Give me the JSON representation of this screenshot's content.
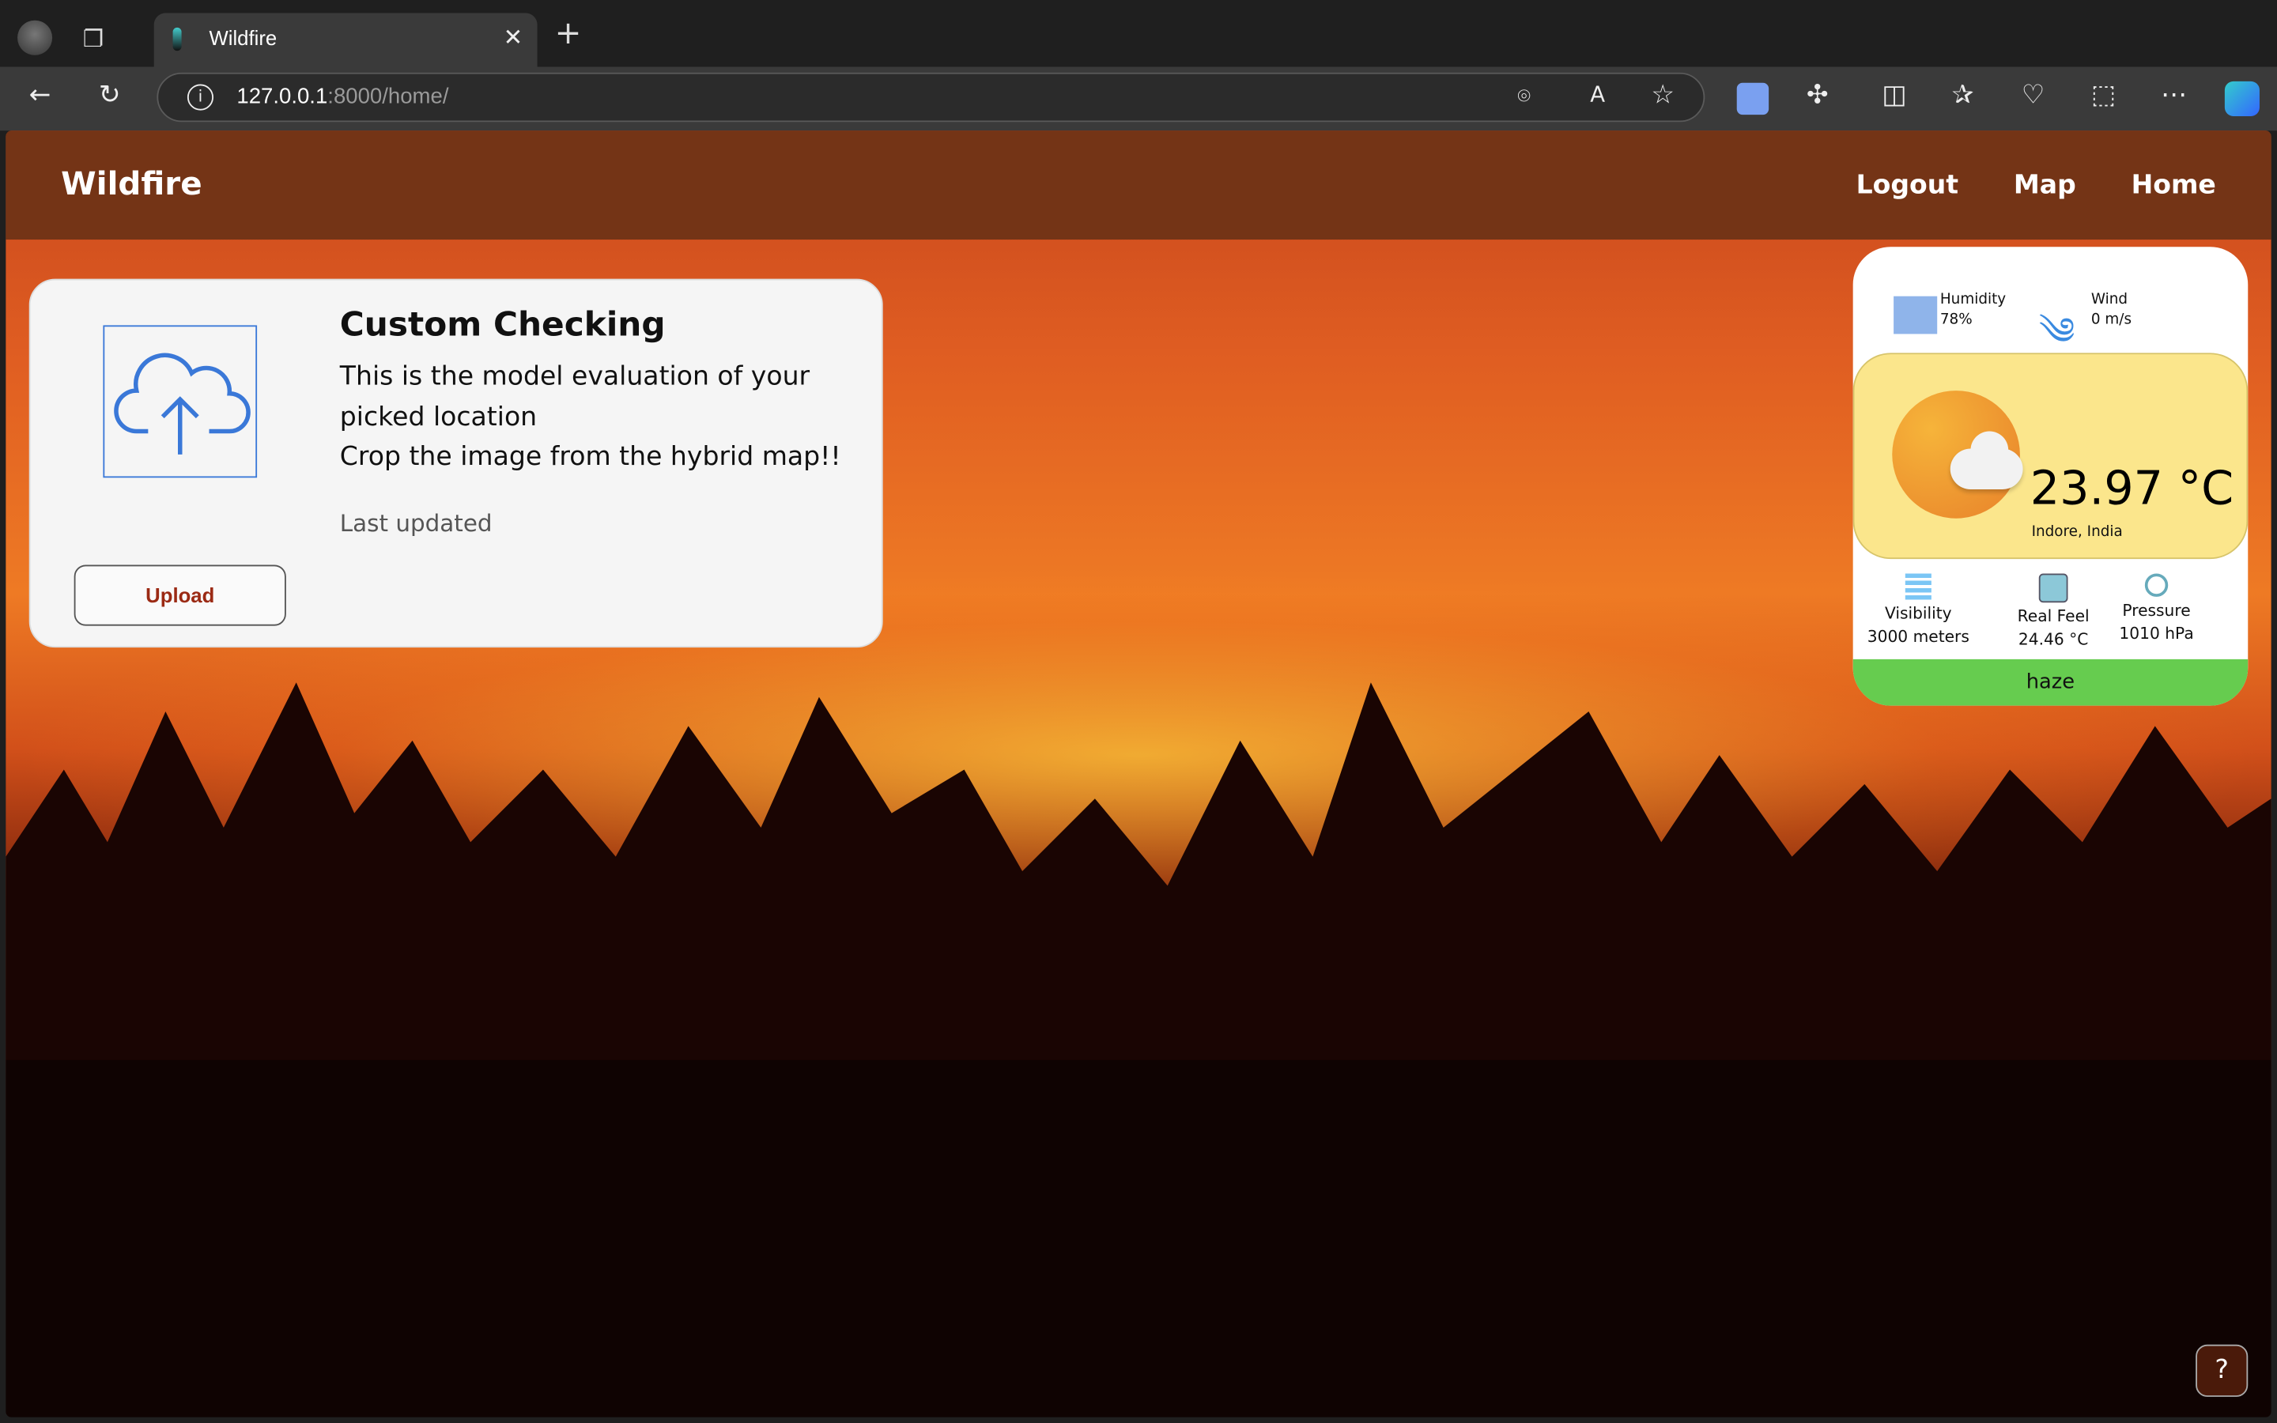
{
  "browser": {
    "tab_title": "Wildfire",
    "url_host": "127.0.0.1",
    "url_rest": ":8000/home/"
  },
  "navbar": {
    "brand": "Wildfire",
    "links": [
      "Logout",
      "Map",
      "Home"
    ]
  },
  "card": {
    "title": "Custom Checking",
    "line1": "This is the model evaluation of your picked location",
    "line2": "Crop the image from the hybrid map!!",
    "last_updated": "Last updated",
    "upload_label": "Upload"
  },
  "weather": {
    "humidity_label": "Humidity",
    "humidity_value": "78%",
    "wind_label": "Wind",
    "wind_value": "0 m/s",
    "temperature": "23.97 °C",
    "location": "Indore, India",
    "visibility_label": "Visibility",
    "visibility_value": "3000 meters",
    "realfeel_label": "Real Feel",
    "realfeel_value": "24.46 °C",
    "pressure_label": "Pressure",
    "pressure_value": "1010 hPa",
    "condition": "haze",
    "colors": {
      "main": "#fbe68c",
      "condition_bar": "#66cc4f"
    }
  },
  "colors": {
    "navbar": "#743416",
    "upload_text": "#9b2a14"
  }
}
